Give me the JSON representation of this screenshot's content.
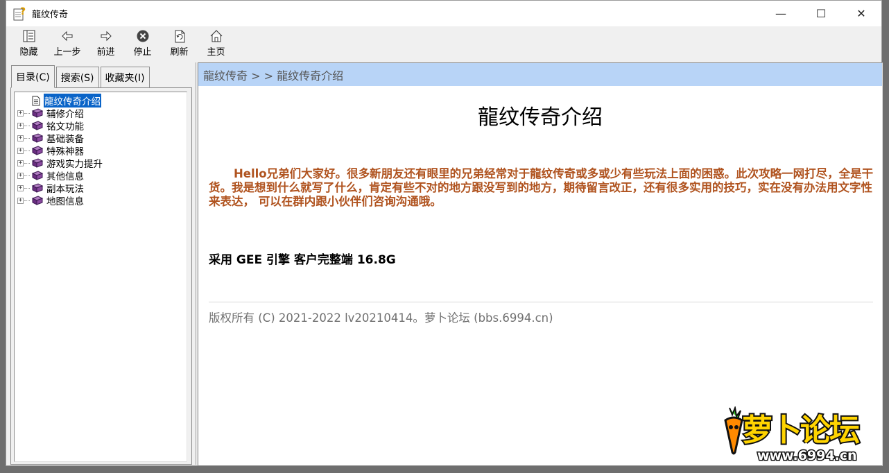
{
  "window": {
    "title": "龍纹传奇",
    "controls": {
      "minimize": "—",
      "maximize": "☐",
      "close": "✕"
    }
  },
  "toolbar": {
    "items": [
      {
        "label": "隐藏",
        "icon": "hide-pane-icon"
      },
      {
        "label": "上一步",
        "icon": "back-arrow-icon"
      },
      {
        "label": "前进",
        "icon": "forward-arrow-icon"
      },
      {
        "label": "停止",
        "icon": "stop-icon"
      },
      {
        "label": "刷新",
        "icon": "refresh-icon"
      },
      {
        "label": "主页",
        "icon": "home-icon"
      }
    ]
  },
  "sidebar": {
    "tabs": [
      {
        "label": "目录(C)",
        "active": true
      },
      {
        "label": "搜索(S)",
        "active": false
      },
      {
        "label": "收藏夹(I)",
        "active": false
      }
    ],
    "tree": [
      {
        "label": "龍纹传奇介绍",
        "type": "page",
        "selected": true
      },
      {
        "label": "辅修介绍",
        "type": "book"
      },
      {
        "label": "铭文功能",
        "type": "book"
      },
      {
        "label": "基础装备",
        "type": "book"
      },
      {
        "label": "特殊神器",
        "type": "book"
      },
      {
        "label": "游戏实力提升",
        "type": "book"
      },
      {
        "label": "其他信息",
        "type": "book"
      },
      {
        "label": "副本玩法",
        "type": "book"
      },
      {
        "label": "地图信息",
        "type": "book"
      }
    ]
  },
  "content": {
    "breadcrumb": "龍纹传奇 > > 龍纹传奇介绍",
    "title": "龍纹传奇介绍",
    "intro": "Hello兄弟们大家好。很多新朋友还有眼里的兄弟经常对于龍纹传奇或多或少有些玩法上面的困惑。此次攻略一网打尽，全是干货。我是想到什么就写了什么，肯定有些不对的地方跟没写到的地方，期待留言改正，还有很多实用的技巧，实在没有办法用文字性来表达， 可以在群内跟小伙伴们咨询沟通哦。",
    "engine": "采用 GEE 引擎  客户完整端 16.8G",
    "copyright": "版权所有 (C) 2021-2022 lv20210414。萝卜论坛 (bbs.6994.cn)"
  },
  "watermark": {
    "brand": "萝卜论坛",
    "url": "www.6994.cn"
  },
  "colors": {
    "breadcrumb_bg": "#b8d4f7",
    "intro_text": "#b0531f",
    "selection": "#0a64c8"
  }
}
